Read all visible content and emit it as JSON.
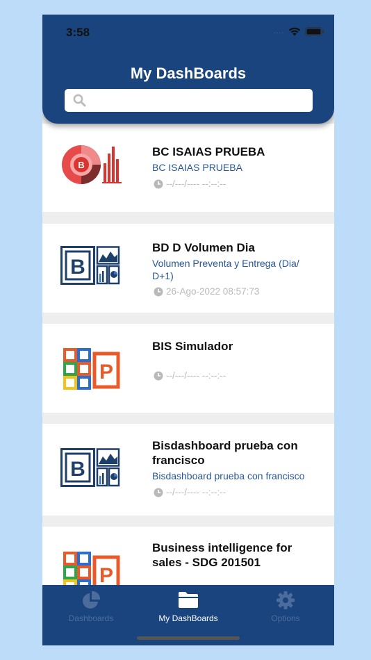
{
  "status_bar": {
    "time": "3:58",
    "signal_dots": "....",
    "icons": [
      "wifi-icon",
      "battery-icon"
    ]
  },
  "header": {
    "title": "My DashBoards",
    "search_placeholder": ""
  },
  "dashboards": [
    {
      "name": "BC ISAIAS PRUEBA",
      "subtitle": "BC ISAIAS PRUEBA",
      "date": "--/---/---- --:--:--",
      "icon": "red-chart-logo"
    },
    {
      "name": "BD D Volumen Dia",
      "subtitle": "Volumen Preventa y Entrega (Dia/ D+1)",
      "date": "26-Ago-2022 08:57:73",
      "icon": "blue-b-chart-logo"
    },
    {
      "name": "BIS Simulador",
      "subtitle": "",
      "date": "--/---/---- --:--:--",
      "icon": "colorful-p-logo"
    },
    {
      "name": "Bisdashboard prueba con francisco",
      "subtitle": "Bisdashboard prueba con francisco",
      "date": "--/---/---- --:--:--",
      "icon": "blue-b-chart-logo"
    },
    {
      "name": "Business intelligence for sales - SDG 201501",
      "subtitle": "",
      "date": "",
      "icon": "colorful-p-logo"
    }
  ],
  "tabbar": {
    "tabs": [
      {
        "label": "Dashboards",
        "icon": "pie-chart-icon",
        "active": false
      },
      {
        "label": "My DashBoards",
        "icon": "folder-icon",
        "active": true
      },
      {
        "label": "Options",
        "icon": "gear-icon",
        "active": false
      }
    ]
  },
  "colors": {
    "primary": "#1a447e",
    "background": "#bcdcf9",
    "subtitle": "#28569a",
    "date": "#b9b9b9"
  }
}
